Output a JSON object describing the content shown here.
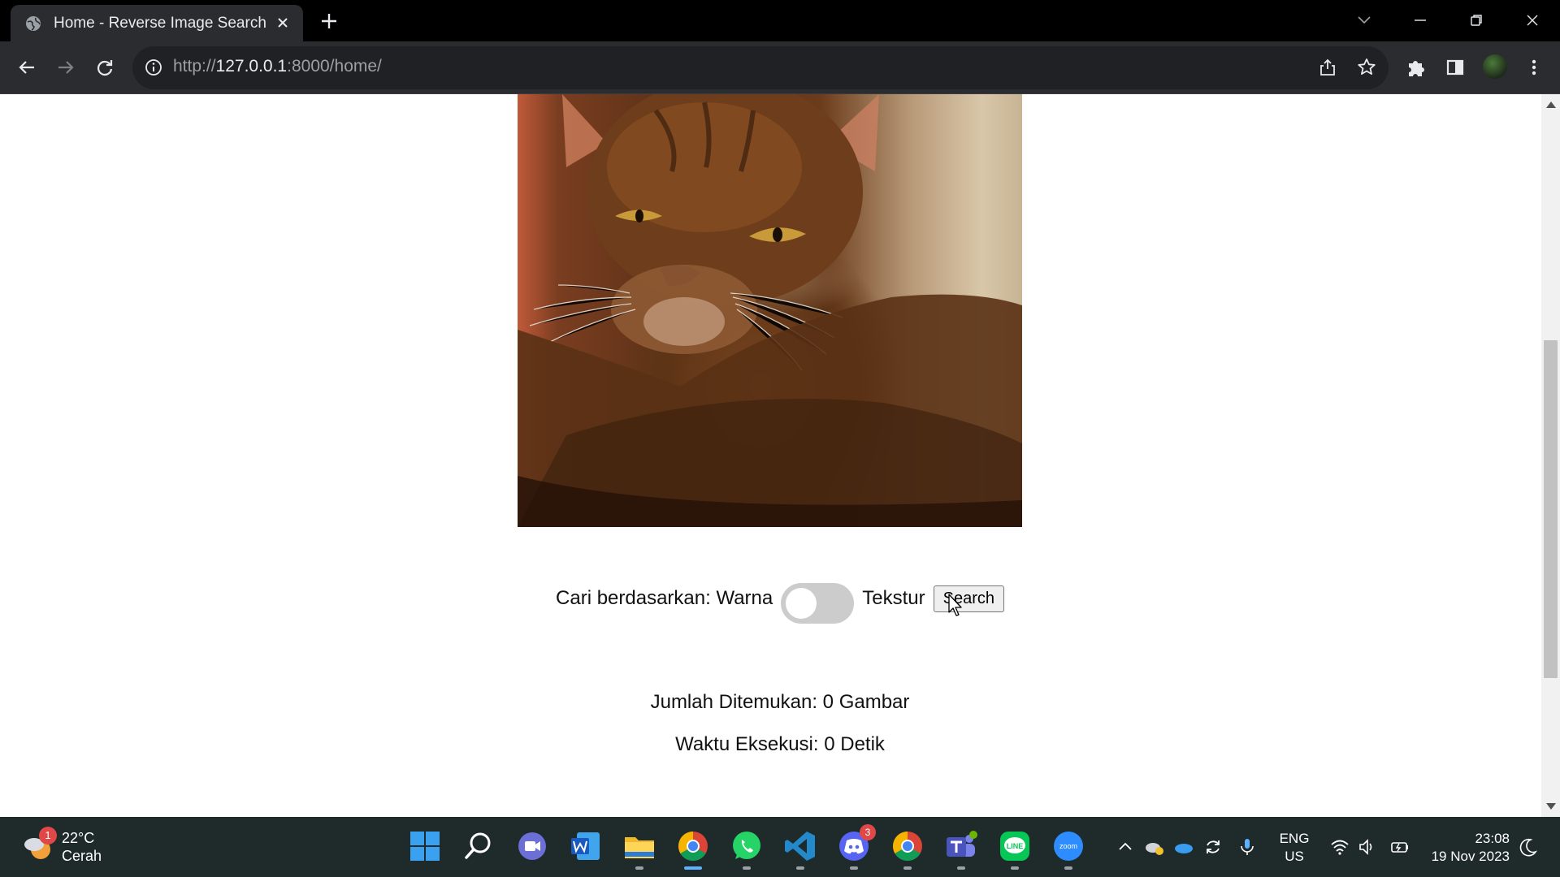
{
  "browser": {
    "tab_title": "Home - Reverse Image Search",
    "url_scheme": "http://",
    "url_host": "127.0.0.1",
    "url_rest": ":8000/home/"
  },
  "page": {
    "image_alt": "Uploaded cat photo",
    "search_by_label": "Cari berdasarkan: Warna",
    "toggle_right_label": "Tekstur",
    "toggle_state": "off",
    "search_button": "Search",
    "found_count": "Jumlah Ditemukan: 0 Gambar",
    "exec_time": "Waktu Eksekusi: 0 Detik"
  },
  "taskbar": {
    "weather_badge": "1",
    "temperature": "22°C",
    "condition": "Cerah",
    "apps": [
      {
        "name": "start-icon"
      },
      {
        "name": "search-icon"
      },
      {
        "name": "meet-icon"
      },
      {
        "name": "word-icon"
      },
      {
        "name": "file-explorer-icon"
      },
      {
        "name": "chrome-icon",
        "active": true
      },
      {
        "name": "whatsapp-icon"
      },
      {
        "name": "vscode-icon"
      },
      {
        "name": "discord-icon",
        "badge": "3"
      },
      {
        "name": "chrome-profile-icon"
      },
      {
        "name": "teams-icon"
      },
      {
        "name": "line-icon"
      },
      {
        "name": "zoom-icon"
      }
    ],
    "discord_badge": "3",
    "zoom_label": "zoom",
    "lang_top": "ENG",
    "lang_bottom": "US",
    "time": "23:08",
    "date": "19 Nov 2023"
  },
  "colors": {
    "tab_bar": "#000000",
    "toolbar": "#2b2c30",
    "taskbar": "#1f2a2b",
    "toggle_off": "#cccccc"
  }
}
